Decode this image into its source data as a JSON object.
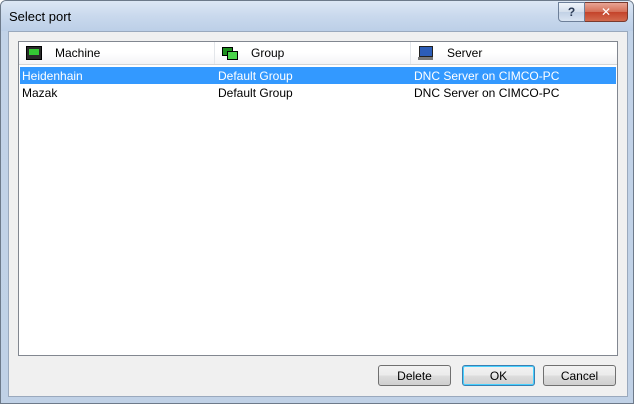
{
  "window": {
    "title": "Select port",
    "help_label": "?",
    "close_label": "✕"
  },
  "list": {
    "columns": [
      {
        "label": "Machine",
        "icon": "machine-icon"
      },
      {
        "label": "Group",
        "icon": "group-icon"
      },
      {
        "label": "Server",
        "icon": "server-icon"
      }
    ],
    "rows": [
      {
        "machine": "Heidenhain",
        "group": "Default Group",
        "server": "DNC Server on CIMCO-PC",
        "selected": true
      },
      {
        "machine": "Mazak",
        "group": "Default Group",
        "server": "DNC Server on CIMCO-PC",
        "selected": false
      }
    ]
  },
  "buttons": {
    "delete": "Delete",
    "ok": "OK",
    "cancel": "Cancel"
  }
}
